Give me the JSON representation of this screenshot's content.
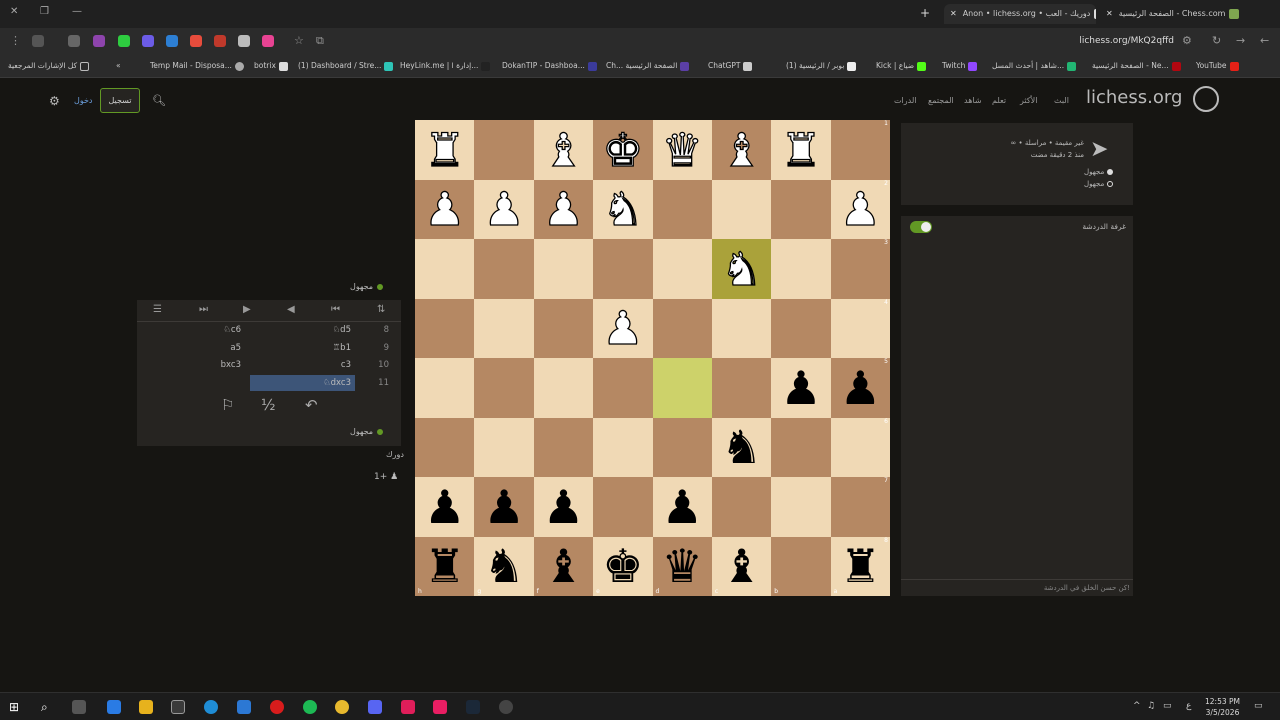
{
  "browser": {
    "tabs": [
      {
        "title": "الصفحة الرئيسية - Chess.com",
        "active": false
      },
      {
        "title": "Anon • lichess.org • دوريك - العب",
        "active": true
      }
    ],
    "url": "lichess.org/MkQ2qffd",
    "bookmarks": [
      "YouTube",
      "الصفحة الرئيسية - Ne...",
      "شاهد | أحدث المسل...",
      "Twitch",
      "Kick | ضياع",
      "(1) بوبر / الرئيسية",
      "ChatGPT",
      "Ch... الصفحة الرئيسية",
      "DokanTIP - Dashboa...",
      "HeyLink.me | إدارة ا...",
      "(1) Dashboard / Stre...",
      "botrix",
      "Temp Mail - Disposa...",
      "كل الإشارات المرجعية"
    ]
  },
  "site": {
    "logo": "lichess.org",
    "nav": [
      "البث",
      "الأكثر",
      "تعلم",
      "شاهد",
      "المجتمع",
      "الدرات"
    ],
    "signin": "تسجيل",
    "register": "دخول"
  },
  "board": {
    "rows": [
      [
        "R",
        "",
        "B",
        "K",
        "Q",
        "B",
        "R",
        ""
      ],
      [
        "P",
        "P",
        "P",
        "N",
        "",
        "",
        "",
        "P"
      ],
      [
        "",
        "",
        "",
        "",
        "",
        "N",
        "",
        ""
      ],
      [
        "",
        "",
        "",
        "P",
        "",
        "",
        "",
        ""
      ],
      [
        "",
        "",
        "",
        "",
        "",
        "",
        "p",
        "p"
      ],
      [
        "",
        "",
        "",
        "",
        "",
        "n",
        "",
        ""
      ],
      [
        "p",
        "p",
        "p",
        "",
        "p",
        "",
        "",
        ""
      ],
      [
        "r",
        "n",
        "b",
        "k",
        "q",
        "b",
        "",
        "r"
      ]
    ],
    "highlight_light": [
      [
        4,
        4
      ]
    ],
    "highlight_dark": [
      [
        2,
        5
      ]
    ],
    "ranks": [
      "1",
      "2",
      "3",
      "4",
      "5",
      "6",
      "7",
      "8"
    ],
    "files": [
      "h",
      "g",
      "f",
      "e",
      "d",
      "c",
      "b",
      "a"
    ]
  },
  "moves": {
    "top_player": "مجهول",
    "bottom_player": "مجهول",
    "rows": [
      {
        "num": "8",
        "white": "♘d5",
        "black": "♘c6"
      },
      {
        "num": "9",
        "white": "♖b1",
        "black": "a5"
      },
      {
        "num": "10",
        "white": "c3",
        "black": "bxc3"
      },
      {
        "num": "11",
        "white": "♘dxc3",
        "black": ""
      }
    ],
    "draw_symbol": "½",
    "opponent_label": "دورك",
    "rating_change": "1+"
  },
  "chat": {
    "game_info_line1": "∞ • غير مقيمة • مراسلة",
    "game_info_line2": "منذ 2 دقيقة مضت",
    "players": [
      "مجهول",
      "مجهول"
    ],
    "room_label": "غرفة الدردشة",
    "input_placeholder": "كن حسن الخلق في الدردشة!"
  },
  "taskbar": {
    "time": "12:53 PM",
    "date": "3/5/2026",
    "lang": "ع"
  }
}
